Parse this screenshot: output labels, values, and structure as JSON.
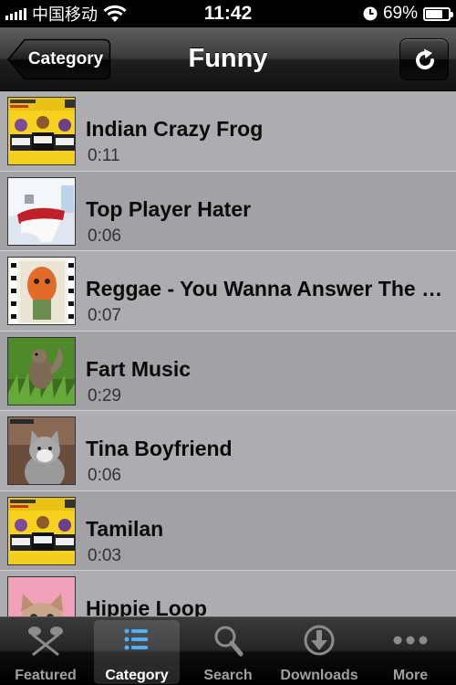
{
  "status_bar": {
    "carrier": "中国移动",
    "time": "11:42",
    "battery_percent": "69",
    "battery_suffix": "%",
    "battery_level": 0.69,
    "icons": [
      "signal-icon",
      "wifi-icon",
      "clock-icon",
      "battery-icon"
    ]
  },
  "nav": {
    "back_label": "Category",
    "title": "Funny",
    "refresh_icon": "refresh-icon"
  },
  "list": {
    "items": [
      {
        "title": "Indian Crazy Frog",
        "duration": "0:11",
        "thumb": "album-art-funky"
      },
      {
        "title": "Top Player Hater",
        "duration": "0:06",
        "thumb": "white-chair-room"
      },
      {
        "title": "Reggae  - You Wanna Answer The Phone",
        "duration": "0:07",
        "thumb": "sonic-youth-cover"
      },
      {
        "title": "Fart Music",
        "duration": "0:29",
        "thumb": "squirrel-on-grass"
      },
      {
        "title": "Tina Boyfriend",
        "duration": "0:06",
        "thumb": "grumpy-cat"
      },
      {
        "title": "Tamilan",
        "duration": "0:03",
        "thumb": "album-art-funky"
      },
      {
        "title": "Hippie Loop",
        "duration": "",
        "thumb": "kitten-pink"
      }
    ]
  },
  "tabs": [
    {
      "label": "Featured",
      "icon": "featured-icon",
      "selected": false
    },
    {
      "label": "Category",
      "icon": "list-icon",
      "selected": true
    },
    {
      "label": "Search",
      "icon": "search-icon",
      "selected": false
    },
    {
      "label": "Downloads",
      "icon": "download-icon",
      "selected": false
    },
    {
      "label": "More",
      "icon": "more-icon",
      "selected": false
    }
  ],
  "colors": {
    "list_bg": "#adadb1",
    "list_bg_alt": "#a2a2a6",
    "tab_selected_text": "#ffffff",
    "tab_text": "#a0a0a0"
  }
}
